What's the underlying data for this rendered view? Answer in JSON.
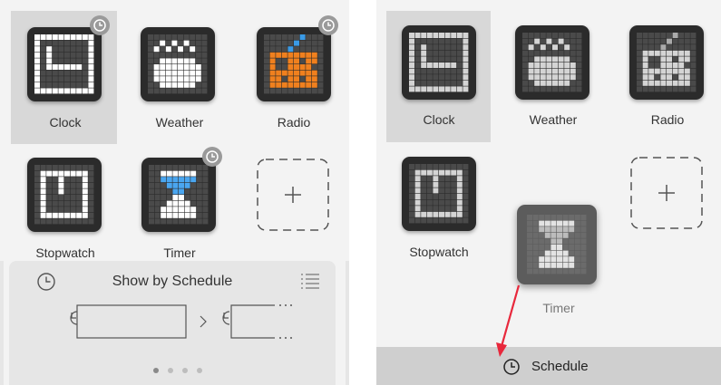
{
  "left_screen": {
    "apps": [
      {
        "label": "Clock",
        "icon": "clock-icon",
        "has_schedule_badge": true,
        "selected": true
      },
      {
        "label": "Weather",
        "icon": "weather-paw-icon",
        "has_schedule_badge": false
      },
      {
        "label": "Radio",
        "icon": "radio-icon",
        "has_schedule_badge": true
      },
      {
        "label": "Stopwatch",
        "icon": "stopwatch-icon",
        "has_schedule_badge": false
      },
      {
        "label": "Timer",
        "icon": "hourglass-icon",
        "has_schedule_badge": true
      },
      {
        "label": "",
        "icon": "plus-icon",
        "is_add_slot": true
      }
    ],
    "schedule_panel": {
      "title": "Show by Schedule",
      "page_dots": 4,
      "active_dot": 0
    }
  },
  "right_screen": {
    "apps": [
      {
        "label": "Clock",
        "icon": "clock-icon",
        "selected": true
      },
      {
        "label": "Weather",
        "icon": "weather-paw-icon"
      },
      {
        "label": "Radio",
        "icon": "radio-icon"
      },
      {
        "label": "Stopwatch",
        "icon": "stopwatch-icon"
      },
      {
        "label": "Timer",
        "icon": "hourglass-icon",
        "dragging": true
      },
      {
        "label": "",
        "icon": "plus-icon",
        "is_add_slot": true
      }
    ],
    "bottom_bar": {
      "label": "Schedule",
      "icon": "clock-icon"
    }
  },
  "colors": {
    "panel_bg": "#f3f3f3",
    "tile_bg": "#2b2b2b",
    "radio_orange": "#f0801e",
    "timer_blue": "#4aa6f0",
    "arrow_red": "#e8283c"
  }
}
